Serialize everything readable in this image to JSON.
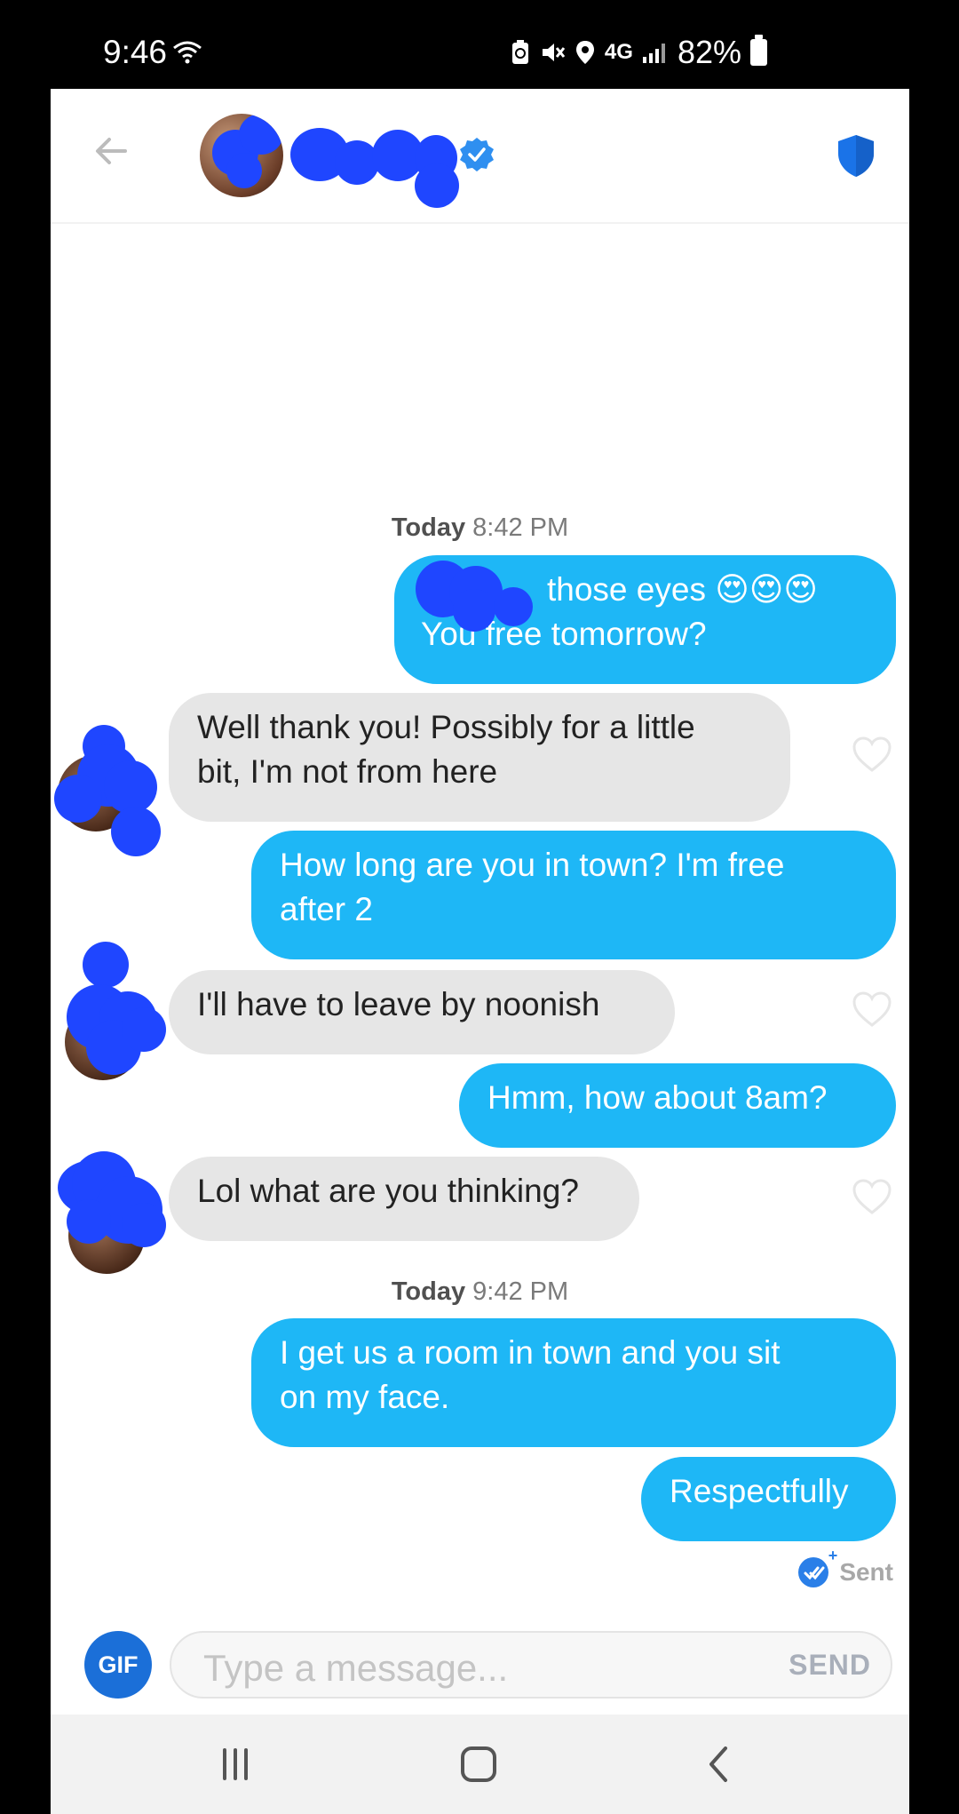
{
  "status_bar": {
    "time": "9:46",
    "network": "4G",
    "battery_percent": "82%",
    "icons": [
      "wifi-icon",
      "battery-saver-icon",
      "mute-icon",
      "location-icon",
      "signal-icon",
      "battery-icon"
    ]
  },
  "header": {
    "back_icon": "arrow-left-icon",
    "verified_icon": "verified-badge-icon",
    "safety_icon": "shield-icon",
    "accent_color": "#1a73e8"
  },
  "conversation": {
    "timestamps": [
      {
        "day": "Today",
        "time": "8:42 PM"
      },
      {
        "day": "Today",
        "time": "9:42 PM"
      }
    ],
    "messages": [
      {
        "from": "me",
        "lines": [
          "those eyes 😍😍😍",
          "You free tomorrow?"
        ]
      },
      {
        "from": "match",
        "lines": [
          "Well thank you! Possibly for a little",
          "bit, I'm not from here"
        ]
      },
      {
        "from": "me",
        "lines": [
          "How long are you in town? I'm free",
          "after 2"
        ]
      },
      {
        "from": "match",
        "lines": [
          "I'll have to leave by noonish"
        ]
      },
      {
        "from": "me",
        "lines": [
          "Hmm,  how about 8am?"
        ]
      },
      {
        "from": "match",
        "lines": [
          "Lol what are you thinking?"
        ]
      },
      {
        "from": "me",
        "lines": [
          "I get us a room in town and  you sit",
          "on my face."
        ]
      },
      {
        "from": "me",
        "lines": [
          "Respectfully"
        ]
      }
    ],
    "sent_label": "Sent",
    "sent_bubble_color": "#1eb7f6",
    "received_bubble_color": "#e6e6e6"
  },
  "composer": {
    "gif_label": "GIF",
    "placeholder": "Type a message...",
    "send_label": "SEND"
  },
  "nav_bar": {
    "icons": [
      "recent-apps-icon",
      "home-icon",
      "back-icon"
    ]
  }
}
